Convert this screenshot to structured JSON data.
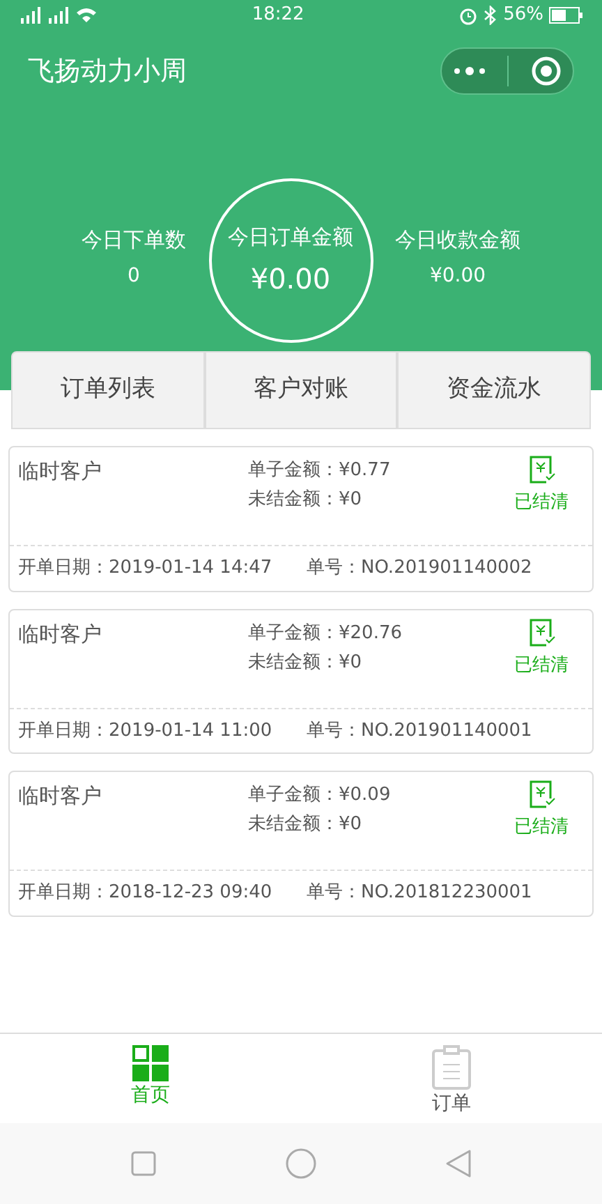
{
  "status_bar": {
    "time": "18:22",
    "battery": "56%"
  },
  "header": {
    "title": "飞扬动力小周"
  },
  "summary": [
    {
      "label": "今日下单数",
      "value": "0",
      "highlight": false
    },
    {
      "label": "今日订单金额",
      "value": "¥0.00",
      "highlight": true
    },
    {
      "label": "今日收款金额",
      "value": "¥0.00",
      "highlight": false
    }
  ],
  "tabs": [
    {
      "label": "订单列表"
    },
    {
      "label": "客户对账"
    },
    {
      "label": "资金流水"
    }
  ],
  "orders": [
    {
      "customer": "临时客户",
      "amount_label": "单子金额：",
      "amount": "¥0.77",
      "unpaid_label": "未结金额：",
      "unpaid": "¥0",
      "status": "已结清",
      "date_label": "开单日期：",
      "date": "2019-01-14 14:47",
      "no_label": "单号：",
      "no": "NO.201901140002"
    },
    {
      "customer": "临时客户",
      "amount_label": "单子金额：",
      "amount": "¥20.76",
      "unpaid_label": "未结金额：",
      "unpaid": "¥0",
      "status": "已结清",
      "date_label": "开单日期：",
      "date": "2019-01-14 11:00",
      "no_label": "单号：",
      "no": "NO.201901140001"
    },
    {
      "customer": "临时客户",
      "amount_label": "单子金额：",
      "amount": "¥0.09",
      "unpaid_label": "未结金额：",
      "unpaid": "¥0",
      "status": "已结清",
      "date_label": "开单日期：",
      "date": "2018-12-23 09:40",
      "no_label": "单号：",
      "no": "NO.201812230001"
    }
  ],
  "tab_bar": [
    {
      "label": "首页",
      "kind": "home",
      "selected": true
    },
    {
      "label": "订单",
      "kind": "orders",
      "selected": false
    }
  ]
}
